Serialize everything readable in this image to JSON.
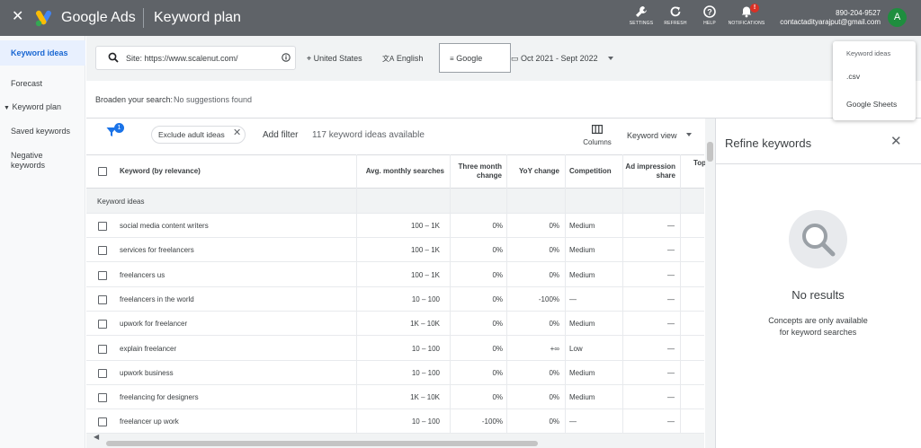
{
  "header": {
    "brand": "Google Ads",
    "page_title": "Keyword plan",
    "tools": [
      {
        "icon": "wrench-icon",
        "label": "SETTINGS"
      },
      {
        "icon": "refresh-icon",
        "label": "REFRESH"
      },
      {
        "icon": "help-icon",
        "label": "HELP"
      },
      {
        "icon": "bell-icon",
        "label": "NOTIFICATIONS",
        "badge": "!"
      }
    ],
    "account_id": "890-204-9527",
    "account_email": "contactadityarajput@gmail.com",
    "avatar_letter": "A"
  },
  "sidebar": {
    "items": [
      {
        "label": "Keyword ideas",
        "active": true
      },
      {
        "label": "Forecast"
      },
      {
        "label": "Keyword plan"
      },
      {
        "label": "Saved keywords"
      },
      {
        "label": "Negative keywords"
      }
    ]
  },
  "filters": {
    "site": "Site: https://www.scalenut.com/",
    "location": "United States",
    "language": "English",
    "network": "Google",
    "date_range": "Oct 2021 - Sept 2022"
  },
  "broaden": {
    "label": "Broaden your search:",
    "value": "No suggestions found"
  },
  "toolbar": {
    "filter_badge": "1",
    "chip": "Exclude adult ideas",
    "add_filter": "Add filter",
    "ideas_count": "117 keyword ideas available",
    "columns": "Columns",
    "view": "Keyword view"
  },
  "table": {
    "headers": {
      "keyword": "Keyword (by relevance)",
      "avg": "Avg. monthly searches",
      "three_month_1": "Three month",
      "three_month_2": "change",
      "yoy": "YoY change",
      "competition": "Competition",
      "ad_impr_1": "Ad impression",
      "ad_impr_2": "share",
      "top": "Top"
    },
    "section_label": "Keyword ideas",
    "rows": [
      {
        "keyword": "social media content writers",
        "avg": "100 – 1K",
        "three": "0%",
        "yoy": "0%",
        "comp": "Medium",
        "share": "—"
      },
      {
        "keyword": "services for freelancers",
        "avg": "100 – 1K",
        "three": "0%",
        "yoy": "0%",
        "comp": "Medium",
        "share": "—"
      },
      {
        "keyword": "freelancers us",
        "avg": "100 – 1K",
        "three": "0%",
        "yoy": "0%",
        "comp": "Medium",
        "share": "—"
      },
      {
        "keyword": "freelancers in the world",
        "avg": "10 – 100",
        "three": "0%",
        "yoy": "-100%",
        "comp": "—",
        "share": "—"
      },
      {
        "keyword": "upwork for freelancer",
        "avg": "1K – 10K",
        "three": "0%",
        "yoy": "0%",
        "comp": "Medium",
        "share": "—"
      },
      {
        "keyword": "explain freelancer",
        "avg": "10 – 100",
        "three": "0%",
        "yoy": "+∞",
        "comp": "Low",
        "share": "—"
      },
      {
        "keyword": "upwork business",
        "avg": "10 – 100",
        "three": "0%",
        "yoy": "0%",
        "comp": "Medium",
        "share": "—"
      },
      {
        "keyword": "freelancing for designers",
        "avg": "1K – 10K",
        "three": "0%",
        "yoy": "0%",
        "comp": "Medium",
        "share": "—"
      },
      {
        "keyword": "freelancer up work",
        "avg": "10 – 100",
        "three": "-100%",
        "yoy": "0%",
        "comp": "—",
        "share": "—"
      }
    ]
  },
  "refine": {
    "title": "Refine keywords",
    "empty_title": "No results",
    "empty_line1": "Concepts are only available",
    "empty_line2": "for keyword searches"
  },
  "download_menu": {
    "heading": "Keyword ideas",
    "items": [
      ".csv",
      "Google Sheets"
    ]
  },
  "colors": {
    "topbar": "#5f6368",
    "accent": "#1a73e8",
    "sidebar_active_bg": "#e8f0fe",
    "notification": "#d93025",
    "avatar": "#1e8e3e"
  }
}
